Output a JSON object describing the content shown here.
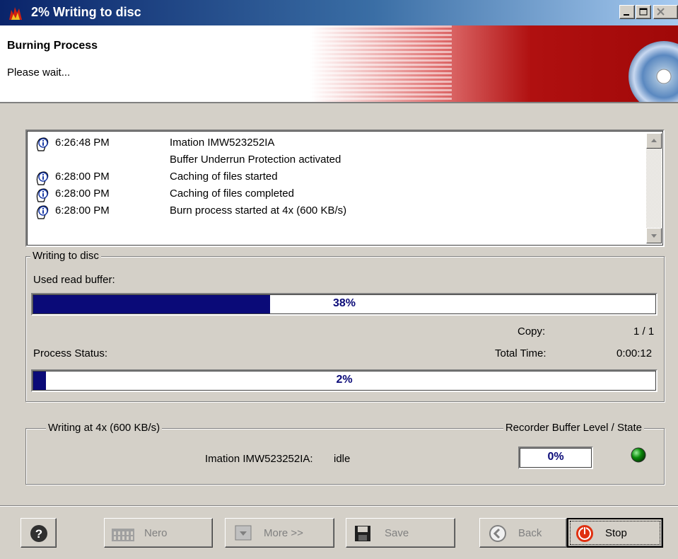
{
  "window": {
    "title": "2% Writing to disc"
  },
  "header": {
    "title": "Burning Process",
    "subtitle": "Please wait..."
  },
  "log": [
    {
      "time": "6:26:48 PM",
      "message": "Imation IMW523252IA",
      "icon": "info-icon"
    },
    {
      "time": "",
      "message": "Buffer Underrun Protection activated",
      "icon": ""
    },
    {
      "time": "6:28:00 PM",
      "message": "Caching of files started",
      "icon": "info-icon"
    },
    {
      "time": "6:28:00 PM",
      "message": "Caching of files completed",
      "icon": "info-icon"
    },
    {
      "time": "6:28:00 PM",
      "message": "Burn process started at 4x (600 KB/s)",
      "icon": "info-icon"
    }
  ],
  "writing_group": {
    "title": "Writing to disc",
    "read_buffer_label": "Used read buffer:",
    "read_buffer_pct": 38,
    "read_buffer_text": "38%",
    "copy_label": "Copy:",
    "copy_value": "1 / 1",
    "total_time_label": "Total Time:",
    "total_time_value": "0:00:12",
    "process_status_label": "Process Status:",
    "process_pct": 2,
    "process_text": "2%"
  },
  "recorder_group": {
    "title_left": "Writing at 4x (600 KB/s)",
    "title_right": "Recorder Buffer Level / State",
    "device_label": "Imation IMW523252IA:",
    "device_state": "idle",
    "buffer_level": "0%",
    "status_led_color": "#0a8a0a"
  },
  "buttons": {
    "help": "?",
    "nero": "Nero",
    "more": "More >>",
    "save": "Save",
    "back": "Back",
    "stop": "Stop"
  },
  "colors": {
    "accent": "#0a0a78",
    "title_bar": "#0a246a",
    "banner_red": "#b01010"
  }
}
